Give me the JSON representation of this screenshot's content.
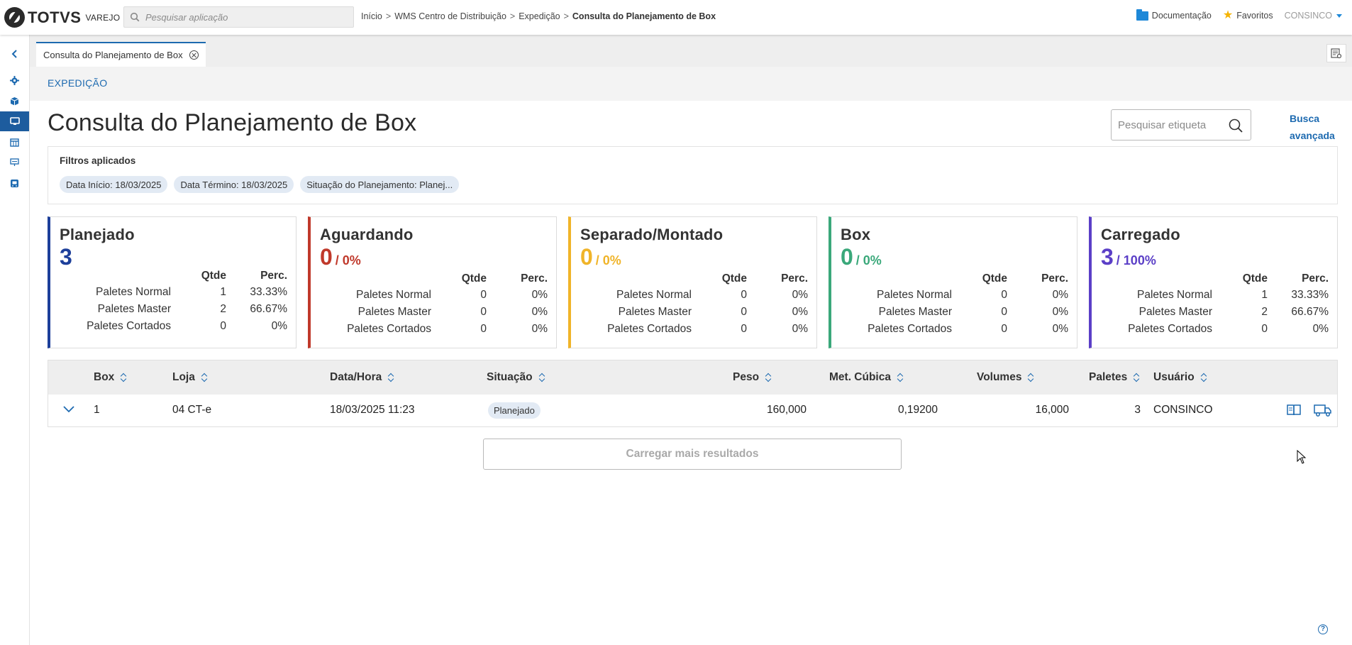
{
  "brand": {
    "name": "TOTVS",
    "product": "VAREJO"
  },
  "app_search": {
    "placeholder": "Pesquisar aplicação"
  },
  "breadcrumb": [
    "Início",
    "WMS Centro de Distribuição",
    "Expedição",
    "Consulta do Planejamento de Box"
  ],
  "breadcrumb_sep": ">",
  "top_links": {
    "docs": "Documentação",
    "favorites": "Favoritos",
    "user": "CONSINCO"
  },
  "tab": {
    "label": "Consulta do Planejamento de Box"
  },
  "section": "EXPEDIÇÃO",
  "page_title": "Consulta do Planejamento de Box",
  "tag_search": {
    "placeholder": "Pesquisar etiqueta"
  },
  "advanced_search": [
    "Busca",
    "avançada"
  ],
  "filters": {
    "title": "Filtros aplicados",
    "chips": [
      "Data Início: 18/03/2025",
      "Data Término: 18/03/2025",
      "Situação do Planejamento: Planej..."
    ]
  },
  "cards": [
    {
      "title": "Planejado",
      "total": "3",
      "percent": "",
      "color": "#1d3f9a",
      "qty_header": "Qtde",
      "pct_header": "Perc.",
      "rows": [
        {
          "label": "Paletes Normal",
          "qty": "1",
          "pct": "33.33%"
        },
        {
          "label": "Paletes Master",
          "qty": "2",
          "pct": "66.67%"
        },
        {
          "label": "Paletes Cortados",
          "qty": "0",
          "pct": "0%"
        }
      ]
    },
    {
      "title": "Aguardando",
      "total": "0",
      "percent": "/ 0%",
      "color": "#c0392b",
      "qty_header": "Qtde",
      "pct_header": "Perc.",
      "rows": [
        {
          "label": "Paletes Normal",
          "qty": "0",
          "pct": "0%"
        },
        {
          "label": "Paletes Master",
          "qty": "0",
          "pct": "0%"
        },
        {
          "label": "Paletes Cortados",
          "qty": "0",
          "pct": "0%"
        }
      ]
    },
    {
      "title": "Separado/Montado",
      "total": "0",
      "percent": "/ 0%",
      "color": "#f0b429",
      "qty_header": "Qtde",
      "pct_header": "Perc.",
      "rows": [
        {
          "label": "Paletes Normal",
          "qty": "0",
          "pct": "0%"
        },
        {
          "label": "Paletes Master",
          "qty": "0",
          "pct": "0%"
        },
        {
          "label": "Paletes Cortados",
          "qty": "0",
          "pct": "0%"
        }
      ]
    },
    {
      "title": "Box",
      "total": "0",
      "percent": "/ 0%",
      "color": "#3aa87a",
      "qty_header": "Qtde",
      "pct_header": "Perc.",
      "rows": [
        {
          "label": "Paletes Normal",
          "qty": "0",
          "pct": "0%"
        },
        {
          "label": "Paletes Master",
          "qty": "0",
          "pct": "0%"
        },
        {
          "label": "Paletes Cortados",
          "qty": "0",
          "pct": "0%"
        }
      ]
    },
    {
      "title": "Carregado",
      "total": "3",
      "percent": "/ 100%",
      "color": "#5b3fc7",
      "qty_header": "Qtde",
      "pct_header": "Perc.",
      "rows": [
        {
          "label": "Paletes Normal",
          "qty": "1",
          "pct": "33.33%"
        },
        {
          "label": "Paletes Master",
          "qty": "2",
          "pct": "66.67%"
        },
        {
          "label": "Paletes Cortados",
          "qty": "0",
          "pct": "0%"
        }
      ]
    }
  ],
  "table": {
    "columns": [
      "Box",
      "Loja",
      "Data/Hora",
      "Situação",
      "Peso",
      "Met. Cúbica",
      "Volumes",
      "Paletes",
      "Usuário"
    ],
    "rows": [
      {
        "box": "1",
        "loja": "04 CT-e",
        "datahora": "18/03/2025 11:23",
        "situacao": "Planejado",
        "peso": "160,000",
        "met_cubica": "0,19200",
        "volumes": "16,000",
        "paletes": "3",
        "usuario": "CONSINCO"
      }
    ]
  },
  "load_more": "Carregar mais resultados",
  "help": "?",
  "colors": {
    "accent": "#1d6ab0",
    "sidebar_active": "#1d5c9e"
  }
}
